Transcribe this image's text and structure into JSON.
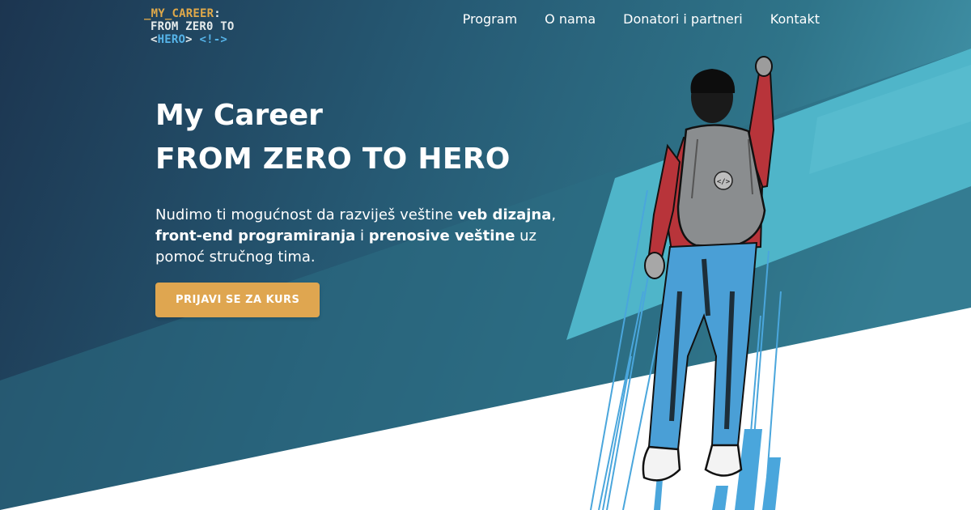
{
  "header": {
    "logo": {
      "line1": "_MY_CAREER",
      "line1_colon": ":",
      "line2": "FROM ZER0 TO",
      "line3_open": "<",
      "line3_hero": "HERO",
      "line3_close": ">",
      "line3_comment": "<!->"
    },
    "nav": [
      {
        "label": "Program"
      },
      {
        "label": "O nama"
      },
      {
        "label": "Donatori i partneri"
      },
      {
        "label": "Kontakt"
      }
    ]
  },
  "hero": {
    "title_line1": "My Career",
    "title_line2": "FROM ZERO TO HERO",
    "description": {
      "p1": "Nudimo ti mogućnost da razviješ veštine ",
      "b1": "veb dizajna",
      "p2": ", ",
      "b2": "front-end programiranja",
      "p3": " i ",
      "b3": "prenosive veštine",
      "p4": " uz pomoć stručnog tima."
    },
    "cta_label": "PRIJAVI SE ZA KURS"
  },
  "illustration": {
    "subject": "person-raising-fist-with-backpack",
    "backpack_badge": "</>"
  },
  "colors": {
    "bg_dark": "#1c3550",
    "bg_mid": "#2e6a80",
    "bg_light": "#4bb3c8",
    "accent_button": "#dfa650",
    "logo_orange": "#e0a94a",
    "logo_blue": "#56b4e9",
    "shirt_red": "#b8343a",
    "jeans_blue": "#4a9fd6",
    "backpack_gray": "#8a8d8f"
  }
}
